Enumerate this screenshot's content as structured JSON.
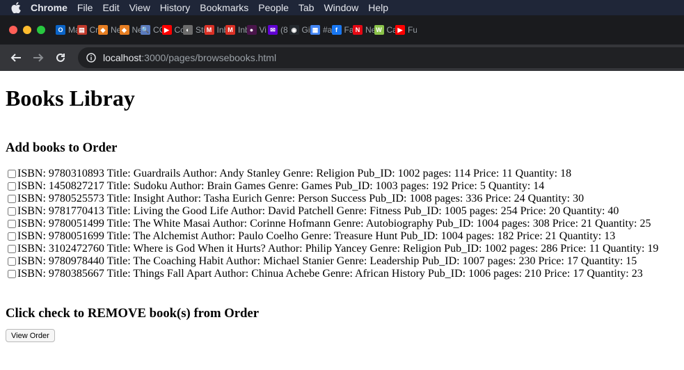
{
  "menubar": {
    "app": "Chrome",
    "items": [
      "File",
      "Edit",
      "View",
      "History",
      "Bookmarks",
      "People",
      "Tab",
      "Window",
      "Help"
    ]
  },
  "tabs": [
    {
      "label": "Ma",
      "icon": "outlook-icon",
      "color": "#0a64c8",
      "glyph": "O"
    },
    {
      "label": "Cr",
      "icon": "chart-icon",
      "color": "#c0392b",
      "glyph": "▤"
    },
    {
      "label": "Ne",
      "icon": "orange-hexagon-icon",
      "color": "#e67e22",
      "glyph": "◆"
    },
    {
      "label": "Ne",
      "icon": "orange-hexagon-icon",
      "color": "#e67e22",
      "glyph": "◆"
    },
    {
      "label": "CC",
      "icon": "magnifier-icon",
      "color": "#5a7bbf",
      "glyph": "🔍"
    },
    {
      "label": "Cc",
      "icon": "youtube-icon",
      "color": "#ff0000",
      "glyph": "▶"
    },
    {
      "label": "Sti",
      "icon": "globe-icon",
      "color": "#6b6b6b",
      "glyph": "◐"
    },
    {
      "label": "Inb",
      "icon": "gmail-icon",
      "color": "#d93025",
      "glyph": "M"
    },
    {
      "label": "Inb",
      "icon": "gmail-icon",
      "color": "#d93025",
      "glyph": "M"
    },
    {
      "label": "Vi",
      "icon": "purple-drop-icon",
      "color": "#4a154b",
      "glyph": "●"
    },
    {
      "label": "(8",
      "icon": "yahoo-mail-icon",
      "color": "#6001d2",
      "glyph": "✉"
    },
    {
      "label": "Gi",
      "icon": "github-icon",
      "color": "#24292e",
      "glyph": "◉"
    },
    {
      "label": "#a",
      "icon": "calendar-icon",
      "color": "#4285f4",
      "glyph": "▦"
    },
    {
      "label": "Fa",
      "icon": "facebook-icon",
      "color": "#1877f2",
      "glyph": "f"
    },
    {
      "label": "Ne",
      "icon": "netflix-icon",
      "color": "#e50914",
      "glyph": "N"
    },
    {
      "label": "Ca",
      "icon": "green-w-icon",
      "color": "#8bc34a",
      "glyph": "W"
    },
    {
      "label": "Fu",
      "icon": "youtube-icon",
      "color": "#ff0000",
      "glyph": "▶"
    }
  ],
  "address": {
    "host": "localhost",
    "rest": ":3000/pages/browsebooks.html"
  },
  "page": {
    "title": "Books Libray",
    "add_heading": "Add books to Order",
    "books": [
      "ISBN: 9780310893 Title: Guardrails Author: Andy Stanley Genre: Religion Pub_ID: 1002 pages: 114 Price: 11 Quantity: 18",
      "ISBN: 1450827217 Title: Sudoku Author: Brain Games Genre: Games Pub_ID: 1003 pages: 192 Price: 5 Quantity: 14",
      "ISBN: 9780525573 Title: Insight Author: Tasha Eurich Genre: Person Success Pub_ID: 1008 pages: 336 Price: 24 Quantity: 30",
      "ISBN: 9781770413 Title: Living the Good Life Author: David Patchell Genre: Fitness Pub_ID: 1005 pages: 254 Price: 20 Quantity: 40",
      "ISBN: 9780051499 Title: The White Masai Author: Corinne Hofmann Genre: Autobiography Pub_ID: 1004 pages: 308 Price: 21 Quantity: 25",
      "ISBN: 9780051699 Title: The Alchemist Author: Paulo Coelho Genre: Treasure Hunt Pub_ID: 1004 pages: 182 Price: 21 Quantity: 13",
      "ISBN: 3102472760 Title: Where is God When it Hurts? Author: Philip Yancey Genre: Religion Pub_ID: 1002 pages: 286 Price: 11 Quantity: 19",
      "ISBN: 9780978440 Title: The Coaching Habit Author: Michael Stanier Genre: Leadership Pub_ID: 1007 pages: 230 Price: 17 Quantity: 15",
      "ISBN: 9780385667 Title: Things Fall Apart Author: Chinua Achebe Genre: African History Pub_ID: 1006 pages: 210 Price: 17 Quantity: 23"
    ],
    "remove_heading": "Click check to REMOVE book(s) from Order",
    "view_order_button": "View Order"
  },
  "colors": {
    "close": "#ff5f57",
    "minimize": "#febc2e",
    "zoom": "#28c840"
  }
}
